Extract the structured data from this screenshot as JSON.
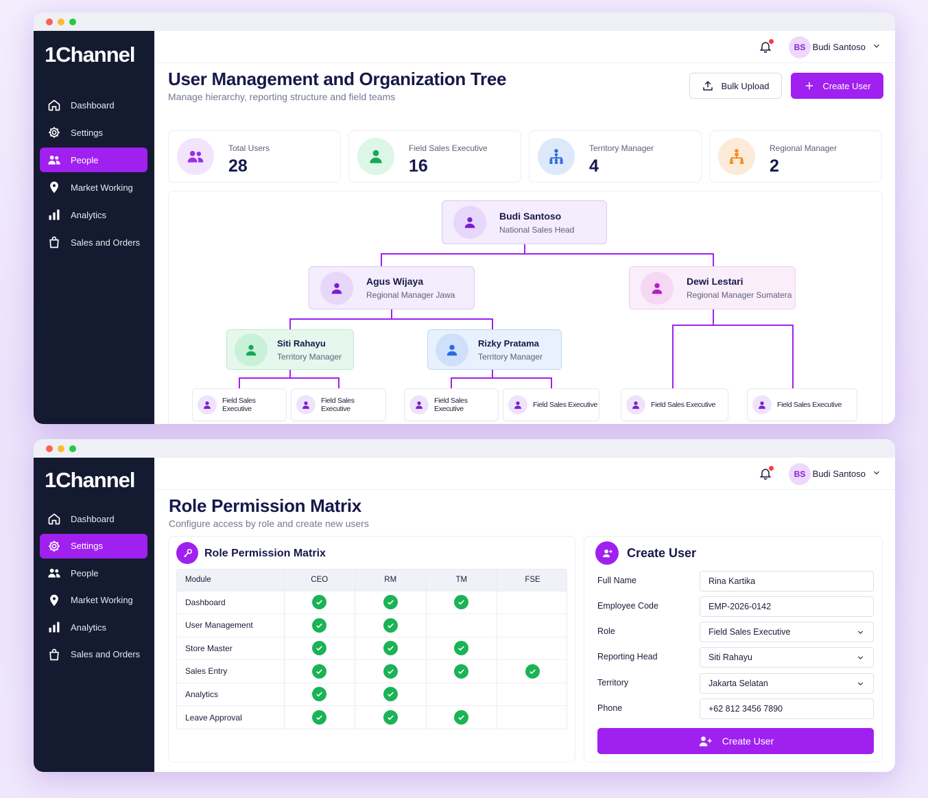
{
  "app": {
    "logo": "1Channel"
  },
  "user": {
    "name": "Budi Santoso",
    "initials": "BS"
  },
  "nav1": [
    {
      "label": "Dashboard",
      "icon": "home-icon"
    },
    {
      "label": "Settings",
      "icon": "gear-icon"
    },
    {
      "label": "People",
      "icon": "users-icon",
      "active": true
    },
    {
      "label": "Market Working",
      "icon": "map-pin-icon"
    },
    {
      "label": "Analytics",
      "icon": "bar-chart-icon"
    },
    {
      "label": "Sales and Orders",
      "icon": "shopping-bag-icon"
    }
  ],
  "nav2": [
    {
      "label": "Dashboard",
      "icon": "home-icon"
    },
    {
      "label": "Settings",
      "icon": "gear-icon",
      "active": true
    },
    {
      "label": "People",
      "icon": "users-icon"
    },
    {
      "label": "Market Working",
      "icon": "map-pin-icon"
    },
    {
      "label": "Analytics",
      "icon": "bar-chart-icon"
    },
    {
      "label": "Sales and Orders",
      "icon": "shopping-bag-icon"
    }
  ],
  "screen1": {
    "title": "User Management and Organization Tree",
    "subtitle": "Manage hierarchy, reporting structure and field teams",
    "bulk_upload": "Bulk Upload",
    "create_user": "Create User",
    "stats": [
      {
        "label": "Total Users",
        "value": "28",
        "color": "#9b2ee8",
        "bg": "#f1e4fc"
      },
      {
        "label": "Field Sales Executive",
        "value": "16",
        "color": "#19a857",
        "bg": "#dcf6e7"
      },
      {
        "label": "Territory Manager",
        "value": "4",
        "color": "#2a6bdc",
        "bg": "#dde9fb"
      },
      {
        "label": "Regional Manager",
        "value": "2",
        "color": "#f28a1b",
        "bg": "#fdebd9"
      }
    ],
    "tree": {
      "root": {
        "name": "Budi Santoso",
        "role": "National Sales Head"
      },
      "rm1": {
        "name": "Agus Wijaya",
        "role": "Regional Manager Jawa"
      },
      "rm2": {
        "name": "Dewi Lestari",
        "role": "Regional Manager Sumatera"
      },
      "tm1": {
        "name": "Siti Rahayu",
        "role": "Territory Manager"
      },
      "tm2": {
        "name": "Rizky Pratama",
        "role": "Territory Manager"
      },
      "leaf_label": "Field Sales Executive"
    }
  },
  "screen2": {
    "title": "Role Permission Matrix",
    "subtitle": "Configure access by role and create new users",
    "matrix": {
      "title": "Role Permission Matrix",
      "columns": [
        "Module",
        "CEO",
        "RM",
        "TM",
        "FSE"
      ],
      "rows": [
        {
          "module": "Dashboard",
          "perms": [
            true,
            true,
            true,
            false
          ]
        },
        {
          "module": "User Management",
          "perms": [
            true,
            true,
            false,
            false
          ]
        },
        {
          "module": "Store Master",
          "perms": [
            true,
            true,
            true,
            false
          ]
        },
        {
          "module": "Sales Entry",
          "perms": [
            true,
            true,
            true,
            true
          ]
        },
        {
          "module": "Analytics",
          "perms": [
            true,
            true,
            false,
            false
          ]
        },
        {
          "module": "Leave Approval",
          "perms": [
            true,
            true,
            true,
            false
          ]
        }
      ]
    },
    "form": {
      "title": "Create User",
      "fields": [
        {
          "label": "Full Name",
          "value": "Rina Kartika",
          "select": false
        },
        {
          "label": "Employee Code",
          "value": "EMP-2026-0142",
          "select": false
        },
        {
          "label": "Role",
          "value": "Field Sales Executive",
          "select": true
        },
        {
          "label": "Reporting Head",
          "value": "Siti Rahayu",
          "select": true
        },
        {
          "label": "Territory",
          "value": "Jakarta Selatan",
          "select": true
        },
        {
          "label": "Phone",
          "value": "+62 812 3456 7890",
          "select": false
        }
      ],
      "submit": "Create User"
    }
  }
}
